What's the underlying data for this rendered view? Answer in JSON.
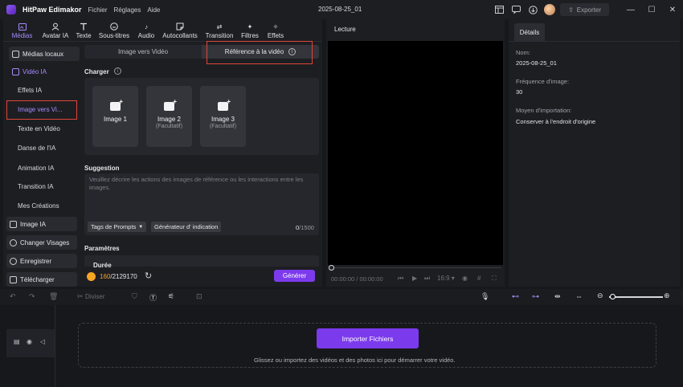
{
  "app": {
    "name": "HitPaw Edimakor",
    "menus": [
      "Fichier",
      "Réglages",
      "Aide"
    ],
    "project_title": "2025-08-25_01",
    "export_label": "Exporter"
  },
  "top_tabs": [
    {
      "label": "Médias",
      "icon": "media-icon",
      "active": true
    },
    {
      "label": "Avatar IA",
      "icon": "avatar-icon"
    },
    {
      "label": "Texte",
      "icon": "text-icon"
    },
    {
      "label": "Sous-titres",
      "icon": "subtitles-icon"
    },
    {
      "label": "Audio",
      "icon": "music-note-icon"
    },
    {
      "label": "Autocollants",
      "icon": "sticker-icon"
    },
    {
      "label": "Transition",
      "icon": "transition-icon"
    },
    {
      "label": "Filtres",
      "icon": "filter-icon"
    },
    {
      "label": "Effets",
      "icon": "effects-icon"
    }
  ],
  "sidebar": {
    "local_media": "Médias locaux",
    "video_ai": "Vidéo IA",
    "sub_items": [
      "Effets IA",
      "Image vers Vi...",
      "Texte en Vidéo",
      "Danse de l'IA",
      "Animation IA",
      "Transition IA",
      "Mes Créations"
    ],
    "image_ai": "Image IA",
    "face_swap": "Changer Visages",
    "record": "Enregistrer",
    "download": "Télécharger"
  },
  "content": {
    "segment_left": "Image vers Vidéo",
    "segment_right": "Référence à la vidéo",
    "charger_title": "Charger",
    "cards": [
      {
        "label": "Image 1",
        "sub": ""
      },
      {
        "label": "Image 2",
        "sub": "(Facultatif)"
      },
      {
        "label": "Image 3",
        "sub": "(Facultatif)"
      }
    ],
    "suggestion_title": "Suggestion",
    "suggestion_placeholder": "Veuillez décrire les actions des images de référence ou les interactions entre les images.",
    "chip_tags": "Tags de Prompts",
    "chip_generator": "Générateur d'  indication",
    "counter_used": "0",
    "counter_max": "/1500",
    "params_title": "Paramètres",
    "params_cut": "Durée",
    "credit_used": "160",
    "credit_total": "/2129170",
    "generate_label": "Générer"
  },
  "preview": {
    "title": "Lecture",
    "time": "00:00:00 / 00:00:00",
    "ratio": "16:9"
  },
  "details": {
    "tab": "Détails",
    "name_label": "Nom:",
    "name_value": "2025-08-25_01",
    "fps_label": "Fréquence d'image:",
    "fps_value": "30",
    "import_label": "Moyen d'importation:",
    "import_value": "Conserver à l'endroit d'origine"
  },
  "timeline": {
    "split_label": "Diviser",
    "import_button": "Importer Fichiers",
    "drop_hint": "Glissez ou importez des vidéos et des photos ici pour démarrer votre vidéo."
  },
  "colors": {
    "accent": "#7c3aed",
    "accent_text": "#a78bfa",
    "highlight_box": "#e0453a",
    "credit": "#f5a524"
  }
}
